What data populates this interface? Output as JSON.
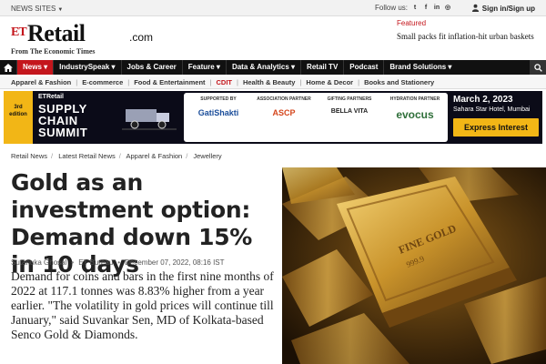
{
  "topbar": {
    "news_sites": "NEWS SITES",
    "follow_us": "Follow us:",
    "social": [
      "twitter-icon",
      "facebook-icon",
      "linkedin-icon",
      "instagram-icon"
    ],
    "sign_in": "Sign in/Sign up"
  },
  "brand": {
    "et": "ET",
    "name": "Retail",
    "domain": ".com",
    "tagline": "From The Economic Times"
  },
  "featured": {
    "label": "Featured",
    "text": "Small packs fit inflation-hit urban baskets"
  },
  "nav": {
    "items": [
      {
        "label": "News",
        "active": true,
        "caret": true
      },
      {
        "label": "IndustrySpeak",
        "caret": true
      },
      {
        "label": "Jobs & Career"
      },
      {
        "label": "Feature",
        "caret": true
      },
      {
        "label": "Data & Analytics",
        "caret": true
      },
      {
        "label": "Retail TV"
      },
      {
        "label": "Podcast"
      },
      {
        "label": "Brand Solutions",
        "caret": true
      }
    ]
  },
  "subnav": {
    "items": [
      "Apparel & Fashion",
      "E-commerce",
      "Food & Entertainment",
      "CDIT",
      "Health & Beauty",
      "Home & Decor",
      "Books and Stationery"
    ]
  },
  "banner": {
    "edition": "3rd edition",
    "brand": "ETRetail",
    "line1": "SUPPLY",
    "line2": "CHAIN",
    "line3": "SUMMIT",
    "partners": [
      {
        "label": "SUPPORTED BY",
        "name": "GatiShakti"
      },
      {
        "label": "ASSOCIATION PARTNER",
        "name": "ASCP"
      },
      {
        "label": "GIFTING PARTNERS",
        "name": "BELLA VITA"
      },
      {
        "label": "HYDRATION PARTNER",
        "name": "evocus"
      }
    ],
    "date": "March 2, 2023",
    "venue": "Sahara Star Hotel, Mumbai",
    "cta": "Express Interest"
  },
  "breadcrumb": [
    "Retail News",
    "Latest Retail News",
    "Apparel & Fashion",
    "Jewellery"
  ],
  "article": {
    "headline": "Gold as an investment option: Demand down 15% in 10 days",
    "author": "Sutanuka Ghosal",
    "source": "ET Bureau",
    "date": "December 07, 2022, 08:16 IST",
    "summary": "Demand for coins and bars in the first nine months of 2022 at 117.1 tonnes was 8.83% higher from a year earlier. \"The volatility in gold prices will continue till January,\" said Suvankar Sen, MD of Kolkata-based Senco Gold & Diamonds."
  },
  "colors": {
    "brand_red": "#c4161c",
    "nav_bg": "#111111",
    "accent_yellow": "#f2b616"
  }
}
